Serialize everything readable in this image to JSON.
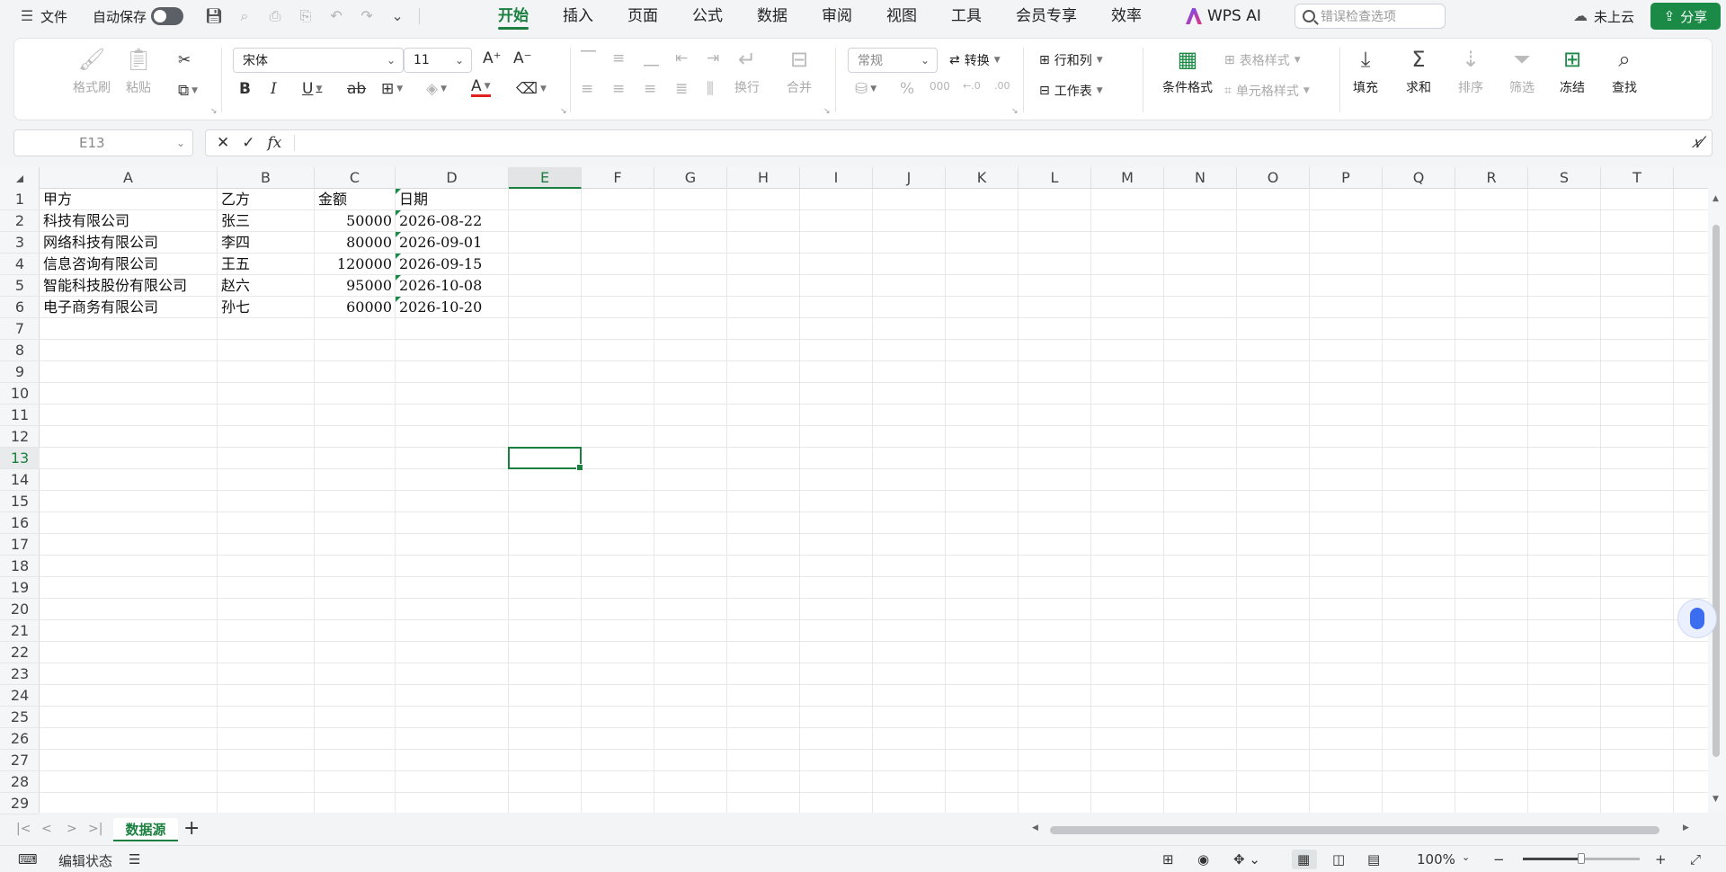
{
  "topbar": {
    "menu_label": "文件",
    "autosave_label": "自动保存",
    "tabs": [
      "开始",
      "插入",
      "页面",
      "公式",
      "数据",
      "审阅",
      "视图",
      "工具",
      "会员专享",
      "效率"
    ],
    "active_tab": "开始",
    "wps_ai_label": "WPS AI",
    "search_placeholder": "错误检查选项",
    "cloud_label": "未上云",
    "share_label": "分享"
  },
  "ribbon": {
    "format_painter": "格式刷",
    "paste": "粘贴",
    "font_name": "宋体",
    "font_size": "11",
    "number_format": "常规",
    "convert": "转换",
    "row_col": "行和列",
    "worksheet": "工作表",
    "wrap": "换行",
    "merge": "合并",
    "cond_format": "条件格式",
    "table_style": "表格样式",
    "cell_style": "单元格样式",
    "fill": "填充",
    "sum": "求和",
    "sort": "排序",
    "filter": "筛选",
    "freeze": "冻结",
    "find": "查找"
  },
  "formula_bar": {
    "name_box": "E13",
    "fx_label": "fx",
    "content": ""
  },
  "columns": [
    "A",
    "B",
    "C",
    "D",
    "E",
    "F",
    "G",
    "H",
    "I",
    "J",
    "K",
    "L",
    "M",
    "N",
    "O",
    "P",
    "Q",
    "R",
    "S",
    "T"
  ],
  "selected_column": "E",
  "selected_row": "13",
  "rows": [
    "1",
    "2",
    "3",
    "4",
    "5",
    "6",
    "7",
    "8",
    "9",
    "10",
    "11",
    "12",
    "13",
    "14",
    "15",
    "16",
    "17",
    "18",
    "19",
    "20",
    "21",
    "22",
    "23",
    "24",
    "25",
    "26",
    "27",
    "28",
    "29"
  ],
  "table": {
    "headers": [
      "甲方",
      "乙方",
      "金额",
      "日期"
    ],
    "records": [
      [
        "科技有限公司",
        "张三",
        "50000",
        "2026-08-22"
      ],
      [
        "网络科技有限公司",
        "李四",
        "80000",
        "2026-09-01"
      ],
      [
        "信息咨询有限公司",
        "王五",
        "120000",
        "2026-09-15"
      ],
      [
        "智能科技股份有限公司",
        "赵六",
        "95000",
        "2026-10-08"
      ],
      [
        "电子商务有限公司",
        "孙七",
        "60000",
        "2026-10-20"
      ]
    ]
  },
  "sheet_tabs": [
    "数据源"
  ],
  "status": {
    "edit_state": "编辑状态",
    "zoom": "100%"
  }
}
